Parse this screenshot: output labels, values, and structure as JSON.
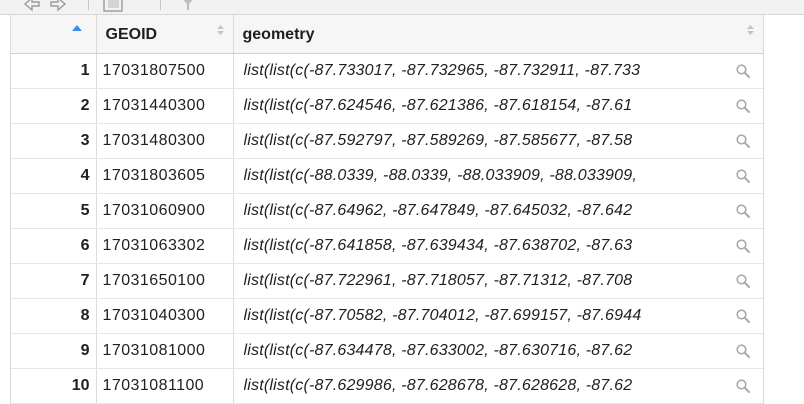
{
  "table": {
    "columns": [
      {
        "label": "",
        "sort": "ascending"
      },
      {
        "label": "GEOID",
        "sort": "none"
      },
      {
        "label": "geometry",
        "sort": "none"
      }
    ],
    "rows": [
      {
        "n": "1",
        "geoid": "17031807500",
        "geometry": "list(list(c(-87.733017, -87.732965, -87.732911, -87.733"
      },
      {
        "n": "2",
        "geoid": "17031440300",
        "geometry": "list(list(c(-87.624546, -87.621386, -87.618154, -87.61"
      },
      {
        "n": "3",
        "geoid": "17031480300",
        "geometry": "list(list(c(-87.592797, -87.589269, -87.585677, -87.58"
      },
      {
        "n": "4",
        "geoid": "17031803605",
        "geometry": "list(list(c(-88.0339, -88.0339, -88.033909, -88.033909,"
      },
      {
        "n": "5",
        "geoid": "17031060900",
        "geometry": "list(list(c(-87.64962, -87.647849, -87.645032, -87.642"
      },
      {
        "n": "6",
        "geoid": "17031063302",
        "geometry": "list(list(c(-87.641858, -87.639434, -87.638702, -87.63"
      },
      {
        "n": "7",
        "geoid": "17031650100",
        "geometry": "list(list(c(-87.722961, -87.718057, -87.71312, -87.708"
      },
      {
        "n": "8",
        "geoid": "17031040300",
        "geometry": "list(list(c(-87.70582, -87.704012, -87.699157, -87.6944"
      },
      {
        "n": "9",
        "geoid": "17031081000",
        "geometry": "list(list(c(-87.634478, -87.633002, -87.630716, -87.62"
      },
      {
        "n": "10",
        "geoid": "17031081100",
        "geometry": "list(list(c(-87.629986, -87.628678, -87.628628, -87.62"
      }
    ]
  },
  "icons": {
    "back": "arrow-left-icon",
    "forward": "arrow-right-icon",
    "show_in_window": "popout-window-icon",
    "filter": "filter-icon",
    "search": "magnifier-icon"
  },
  "colors": {
    "sort_active": "#3b8fe0",
    "sort_inactive": "#c4c4c4",
    "header_bg": "#f6f6f6",
    "grid_border": "#d9d9d9"
  }
}
